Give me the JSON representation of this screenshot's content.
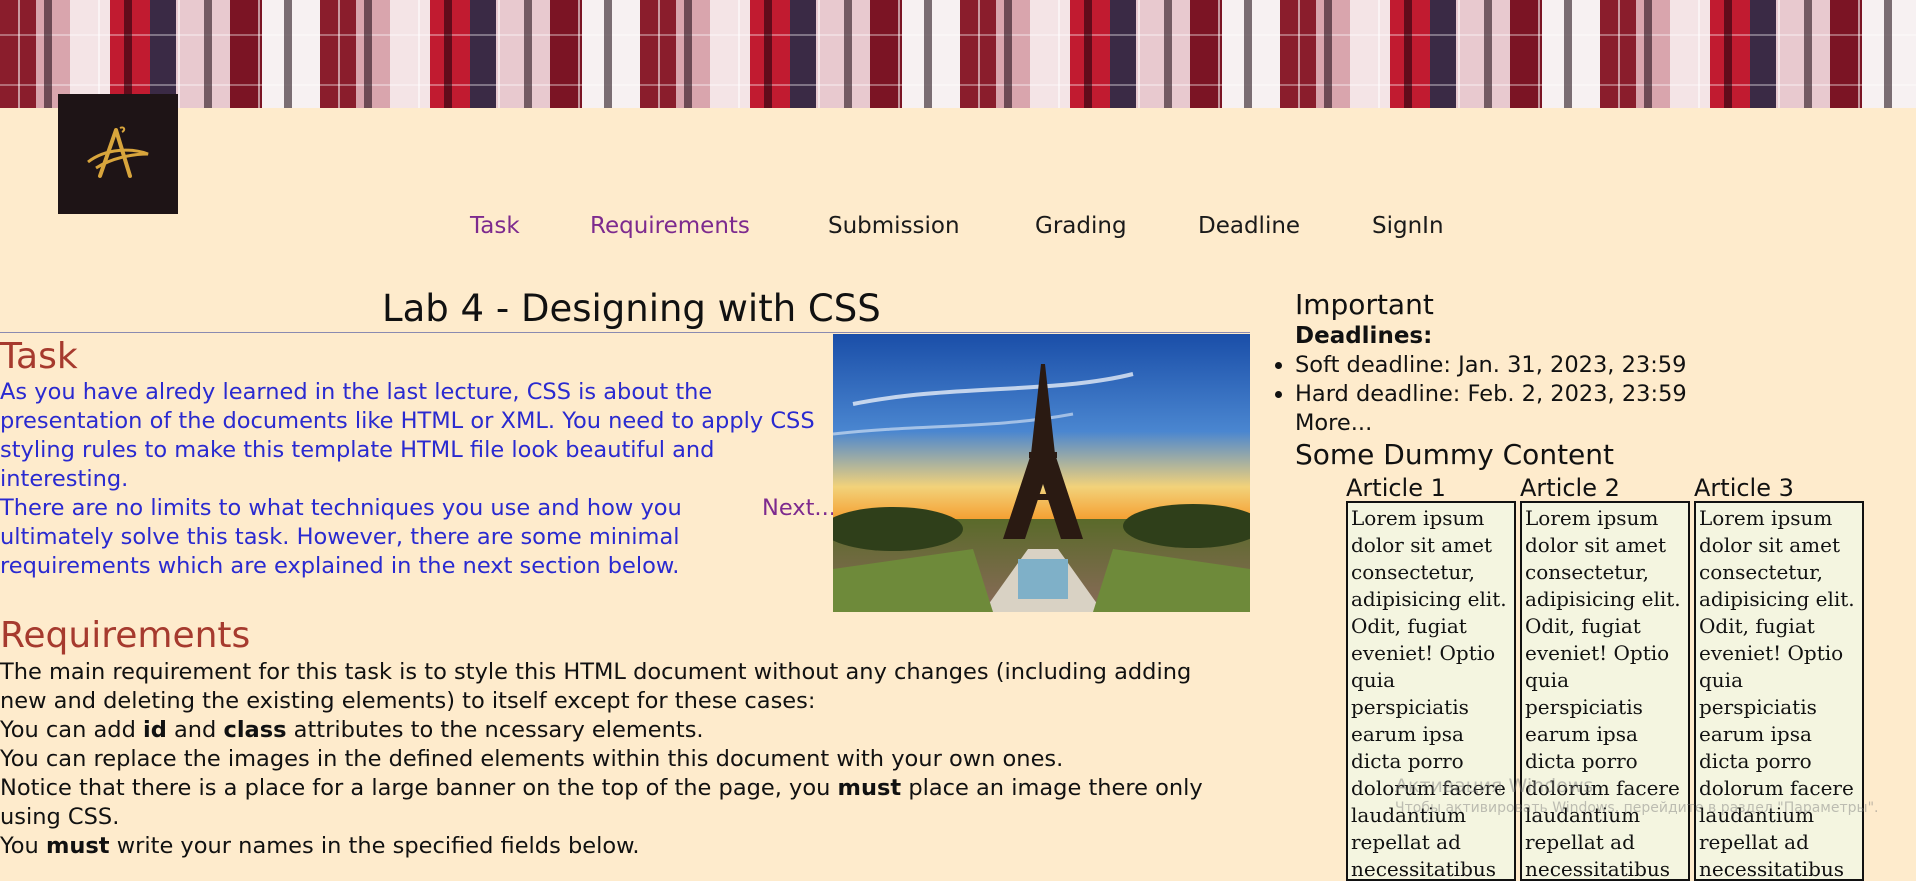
{
  "nav": {
    "items": [
      {
        "label": "Task",
        "visited": true
      },
      {
        "label": "Requirements",
        "visited": true
      },
      {
        "label": "Submission",
        "visited": false
      },
      {
        "label": "Grading",
        "visited": false
      },
      {
        "label": "Deadline",
        "visited": false
      },
      {
        "label": "SignIn",
        "visited": false
      }
    ]
  },
  "logo": {
    "icon": "letter-a-logo-icon",
    "color": "#d8a53c"
  },
  "main": {
    "title": "Lab 4 - Designing with CSS",
    "task": {
      "heading": "Task",
      "p1": "As you have alredy learned in the last lecture, CSS is about the presentation of the documents like HTML or XML. You need to apply CSS styling rules to make this template HTML file look beautiful and interesting.",
      "p2": "There are no limits to what techniques you use and how you ultimately solve this task. However, there are some minimal requirements which are explained in the next section below.",
      "next_link": "Next..."
    },
    "requirements": {
      "heading": "Requirements",
      "line1": "The main requirement for this task is to style this HTML document without any changes (including adding new and deleting the existing elements) to itself except for these cases:",
      "line2_pre": "You can add ",
      "line2_b1": "id",
      "line2_mid": " and ",
      "line2_b2": "class",
      "line2_post": " attributes to the ncessary elements.",
      "line3": "You can replace the images in the defined elements within this document with your own ones.",
      "line4_pre": "Notice that there is a place for a large banner on the top of the page, you ",
      "line4_b": "must",
      "line4_post": " place an image there only using CSS.",
      "line5_pre": "You ",
      "line5_b": "must",
      "line5_post": " write your names in the specified fields below."
    }
  },
  "aside": {
    "important": "Important",
    "deadlines_label": "Deadlines:",
    "deadlines": [
      "Soft deadline: Jan. 31, 2023, 23:59",
      "Hard deadline: Feb. 2, 2023, 23:59"
    ],
    "more_link": "More...",
    "dummy_title": "Some Dummy Content",
    "articles": [
      {
        "title": "Article 1",
        "body": "Lorem ipsum dolor sit amet consectetur, adipisicing elit. Odit, fugiat eveniet! Optio quia perspiciatis earum ipsa dicta porro dolorum facere laudantium repellat ad necessitatibus"
      },
      {
        "title": "Article 2",
        "body": "Lorem ipsum dolor sit amet consectetur, adipisicing elit. Odit, fugiat eveniet! Optio quia perspiciatis earum ipsa dicta porro dolorum facere laudantium repellat ad necessitatibus"
      },
      {
        "title": "Article 3",
        "body": "Lorem ipsum dolor sit amet consectetur, adipisicing elit. Odit, fugiat eveniet! Optio quia perspiciatis earum ipsa dicta porro dolorum facere laudantium repellat ad necessitatibus"
      }
    ]
  },
  "watermark": {
    "line1": "Активация Windows",
    "line2": "Чтобы активировать Windows, перейдите в раздел \"Параметры\"."
  },
  "colors": {
    "page_bg": "#feebcc",
    "heading_red": "#a63a2e",
    "task_blue": "#2a2ad0",
    "link_visited": "#7d2a8e",
    "article_bg": "#f4f5e0"
  }
}
